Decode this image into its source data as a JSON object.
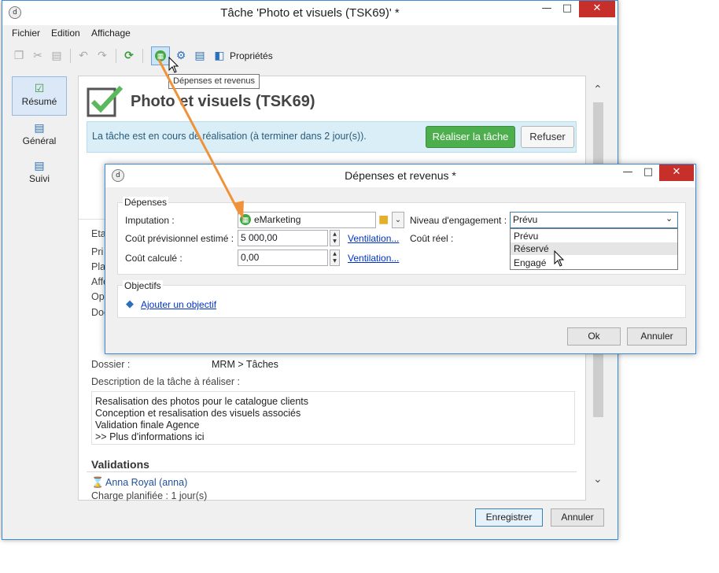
{
  "main_window": {
    "title": "Tâche 'Photo et visuels (TSK69)' *",
    "menu": [
      "Fichier",
      "Edition",
      "Affichage"
    ],
    "toolbar": {
      "properties_label": "Propriétés",
      "tooltip": "Dépenses et revenus"
    },
    "sidebar": [
      {
        "label": "Résumé",
        "icon": "checkmark-icon",
        "active": true
      },
      {
        "label": "Général",
        "icon": "clipboard-icon",
        "active": false
      },
      {
        "label": "Suivi",
        "icon": "tracking-icon",
        "active": false
      }
    ],
    "task_title": "Photo et visuels (TSK69)",
    "banner_text": "La tâche est en cours de réalisation (à terminer dans 2 jour(s)).",
    "do_task_button": "Réaliser la tâche",
    "refuse_button": "Refuser",
    "hidden_labels": [
      "Eta",
      "Pri",
      "Pla",
      "Affe",
      "Op",
      "Doc"
    ],
    "folder_label": "Dossier :",
    "folder_value": "MRM > Tâches",
    "description_label": "Description de la tâche à réaliser :",
    "description_lines": [
      "Resalisation des photos pour le catalogue clients",
      "Conception et resalisation des visuels associés",
      "Validation finale Agence",
      ">> Plus d'informations ici"
    ],
    "validations_title": "Validations",
    "validator_name": "Anna Royal (anna)",
    "planned_charge": "Charge planifiée : 1 jour(s)",
    "save_button": "Enregistrer",
    "cancel_button": "Annuler"
  },
  "dialog": {
    "title": "Dépenses et revenus *",
    "expenses_group": "Dépenses",
    "imputation_label": "Imputation :",
    "imputation_value": "eMarketing",
    "estimated_cost_label": "Coût prévisionnel estimé :",
    "estimated_cost_value": "5 000,00",
    "breakdown_link": "Ventilation...",
    "computed_cost_label": "Coût calculé :",
    "computed_cost_value": "0,00",
    "breakdown_link_2": "Ventilation...",
    "engagement_label": "Niveau d'engagement :",
    "engagement_value": "Prévu",
    "engagement_options": [
      "Prévu",
      "Réservé",
      "Engagé"
    ],
    "real_cost_label": "Coût réel :",
    "objectives_group": "Objectifs",
    "add_objective_link": "Ajouter un objectif",
    "ok_button": "Ok",
    "cancel_button": "Annuler"
  },
  "colors": {
    "accent": "#3d8ad6",
    "green_button": "#4cae4c",
    "close_button": "#c7302a",
    "arrow": "#f0923a",
    "link": "#0033cc"
  }
}
